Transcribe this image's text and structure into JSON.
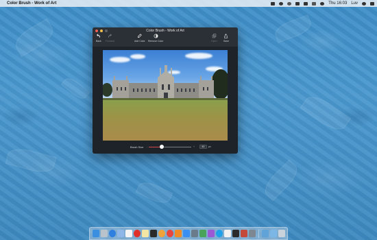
{
  "menubar": {
    "app_name": "Color Brush - Work of Art",
    "clock": "Thu 16:03",
    "user": "Luv",
    "status_icons": [
      "dropbox-icon",
      "wifi-icon",
      "sync-icon",
      "monitor-icon",
      "battery-icon",
      "flag-icon",
      "volume-icon",
      "spotlight-icon",
      "menu-list-icon"
    ]
  },
  "window": {
    "title": "Color Brush - Work of Art",
    "toolbar": {
      "back": "Back",
      "forward": "Forward",
      "add_color": "Add Color",
      "remove_color": "Remove Color",
      "open": "Open",
      "save": "Save"
    },
    "bottom": {
      "brush_label": "Brush Size",
      "slider_min": "-",
      "slider_max": "+",
      "slider_fraction": 0.3,
      "brush_value": "60",
      "unit": "px"
    }
  },
  "dock": {
    "items": [
      {
        "name": "finder-icon",
        "color": "#3a8fe0"
      },
      {
        "name": "launchpad-icon",
        "color": "#b9c3cc"
      },
      {
        "name": "safari-icon",
        "color": "#2f7fe0"
      },
      {
        "name": "mail-icon",
        "color": "#8fb6e8"
      },
      {
        "name": "calendar-icon",
        "color": "#f4f4f4"
      },
      {
        "name": "opera-icon",
        "color": "#e0302a"
      },
      {
        "name": "notes-icon",
        "color": "#f3e6a4"
      },
      {
        "name": "terminal-icon",
        "color": "#2a2a2a"
      },
      {
        "name": "photos-icon",
        "color": "#f2a23a"
      },
      {
        "name": "chrome-icon",
        "color": "#e8453c"
      },
      {
        "name": "ibooks-icon",
        "color": "#f08a24"
      },
      {
        "name": "app-store-icon",
        "color": "#3a8ff0"
      },
      {
        "name": "preview-icon",
        "color": "#6a7b8c"
      },
      {
        "name": "maps-icon",
        "color": "#4aa35a"
      },
      {
        "name": "music-icon",
        "color": "#9b59d6"
      },
      {
        "name": "skype-icon",
        "color": "#1fa0e8"
      },
      {
        "name": "textedit-icon",
        "color": "#f1f1f1"
      },
      {
        "name": "activity-monitor-icon",
        "color": "#2b2b2b"
      },
      {
        "name": "color-brush-icon",
        "color": "#c34a3a"
      },
      {
        "name": "system-prefs-icon",
        "color": "#7d8892"
      }
    ],
    "trailing": [
      {
        "name": "downloads-folder-icon",
        "color": "#5fa3d9"
      },
      {
        "name": "documents-folder-icon",
        "color": "#7ab6e6"
      },
      {
        "name": "trash-icon",
        "color": "#c9d2da"
      }
    ]
  }
}
